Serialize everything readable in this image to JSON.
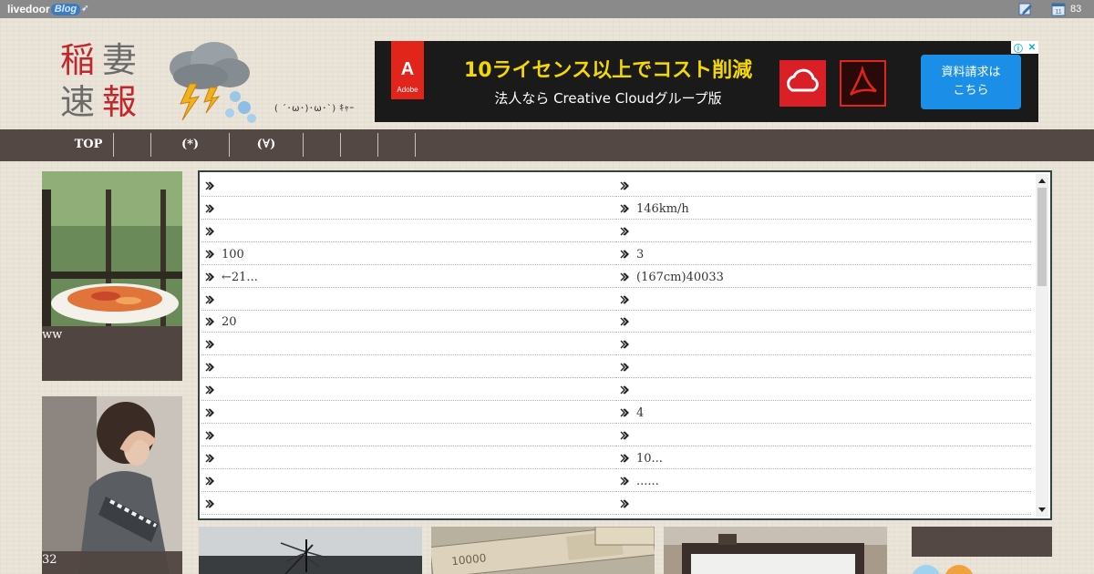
{
  "topbar": {
    "logo_text": "livedoor",
    "logo_blog": "Blog",
    "notification_count": "83",
    "icons": [
      "edit-icon",
      "calendar-icon"
    ]
  },
  "site": {
    "logo_chars": [
      "稲",
      "妻",
      "速",
      "報"
    ],
    "kaomoji": "( ´･ω･)･ω･`) ｷｬｰ",
    "colors": {
      "red": "#c0282d",
      "gray": "#6b6b6b"
    }
  },
  "ad": {
    "brand": "Adobe",
    "headline": "10ライセンス以上でコスト削減",
    "subline": "法人なら Creative Cloudグループ版",
    "cta": "資料請求は\nこちら",
    "choice_icons": [
      "info-icon",
      "close-icon"
    ]
  },
  "nav": {
    "items": [
      "TOP",
      "",
      "(*)",
      "(∀)",
      "",
      "",
      ""
    ]
  },
  "side_cards": [
    {
      "caption": "ww"
    },
    {
      "caption": "32"
    }
  ],
  "feed": {
    "left": [
      "",
      "",
      "",
      "100",
      "←21...",
      "",
      "20",
      "",
      "",
      "",
      "",
      "",
      "",
      "",
      ""
    ],
    "right": [
      "",
      "146km/h",
      "",
      "3",
      "(167cm)40033",
      "",
      "",
      "",
      "",
      "",
      "4",
      "",
      "10...",
      "......",
      ""
    ]
  },
  "colors": {
    "nav_bg": "#544844",
    "feed_border": "#34453f",
    "ad_bg": "#1a1a1a",
    "ad_headline": "#f5d800",
    "ad_cta": "#1b8fe8"
  }
}
